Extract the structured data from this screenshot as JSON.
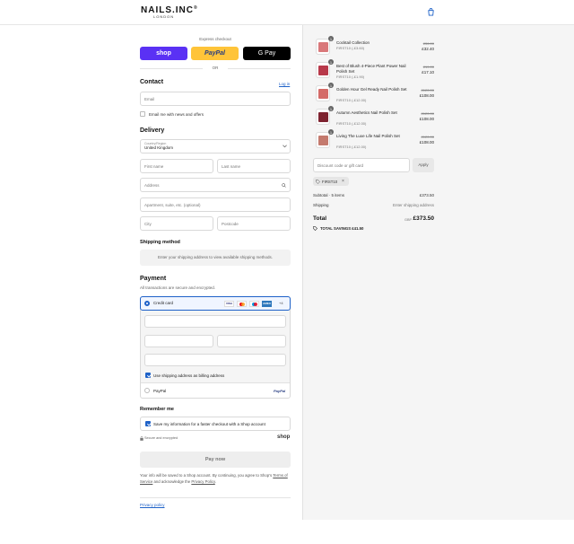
{
  "brand": {
    "logo": "NAILS.INC",
    "reg": "®",
    "sub": "LONDON"
  },
  "express": {
    "title": "Express checkout",
    "shop": "shop",
    "paypal": "PayPal",
    "gpay": "G Pay",
    "or": "OR"
  },
  "contact": {
    "heading": "Contact",
    "login": "Log in",
    "email_placeholder": "Email",
    "news_label": "Email me with news and offers"
  },
  "delivery": {
    "heading": "Delivery",
    "country_label": "Country/Region",
    "country_value": "United Kingdom",
    "first_name": "First name",
    "last_name": "Last name",
    "address": "Address",
    "apartment": "Apartment, suite, etc. (optional)",
    "city": "City",
    "postcode": "Postcode"
  },
  "shipping": {
    "heading": "Shipping method",
    "note": "Enter your shipping address to view available shipping methods."
  },
  "payment": {
    "heading": "Payment",
    "subtitle": "All transactions are secure and encrypted.",
    "credit_card": "Credit card",
    "cards": [
      "VISA",
      "MC",
      "MAES",
      "AMEX"
    ],
    "more_cards": "+4",
    "billing_label": "Use shipping address as billing address",
    "paypal_label": "PayPal",
    "paypal_logo": "PayPal"
  },
  "remember": {
    "heading": "Remember me",
    "save_label": "Save my information for a faster checkout with a Shop account",
    "secure": "Secure and encrypted",
    "shop_logo": "shop"
  },
  "pay_now": "Pay now",
  "legal": {
    "text": "Your info will be saved to a Shop account. By continuing, you agree to Shop’s",
    "terms": "Terms of Service",
    "and": "and acknowledge the",
    "privacy": "Privacy Policy",
    "period": "."
  },
  "privacy_policy_link": "Privacy policy",
  "order": {
    "items": [
      {
        "name": "Cocktail Collection",
        "discount": "FIRST10 (-£3.60)",
        "old": "£36.00",
        "price": "£32.40",
        "qty": "1",
        "color": "#d9787a"
      },
      {
        "name": "Best of Blush 4-Piece Plant Power Nail Polish Set",
        "discount": "FIRST10 (-£1.90)",
        "old": "£19.00",
        "price": "£17.10",
        "qty": "1",
        "color": "#b8394a"
      },
      {
        "name": "Golden Hour Gel Ready Nail Polish Set",
        "discount": "FIRST10 (-£12.00)",
        "old": "£120.00",
        "price": "£108.00",
        "qty": "1",
        "color": "#d46a67"
      },
      {
        "name": "Autumn Aesthetics Nail Polish Set",
        "discount": "FIRST10 (-£12.00)",
        "old": "£120.00",
        "price": "£108.00",
        "qty": "1",
        "color": "#7e2330"
      },
      {
        "name": "Living The Luxe Life Nail Polish Set",
        "discount": "FIRST10 (-£12.00)",
        "old": "£120.00",
        "price": "£108.00",
        "qty": "1",
        "color": "#c47a6e"
      }
    ],
    "discount_placeholder": "Discount code or gift card",
    "apply": "Apply",
    "code_tag": "FIRST10",
    "subtotal_label": "Subtotal · 5 items",
    "subtotal_value": "£373.50",
    "shipping_label": "Shipping",
    "shipping_value": "Enter shipping address",
    "total_label": "Total",
    "currency": "GBP",
    "total_value": "£373.50",
    "savings_label": "TOTAL SAVINGS",
    "savings_value": "£41.50"
  },
  "colors": {
    "shop_purple": "#5a31f4",
    "paypal_yellow": "#ffc439",
    "link_blue": "#1f62c8"
  }
}
